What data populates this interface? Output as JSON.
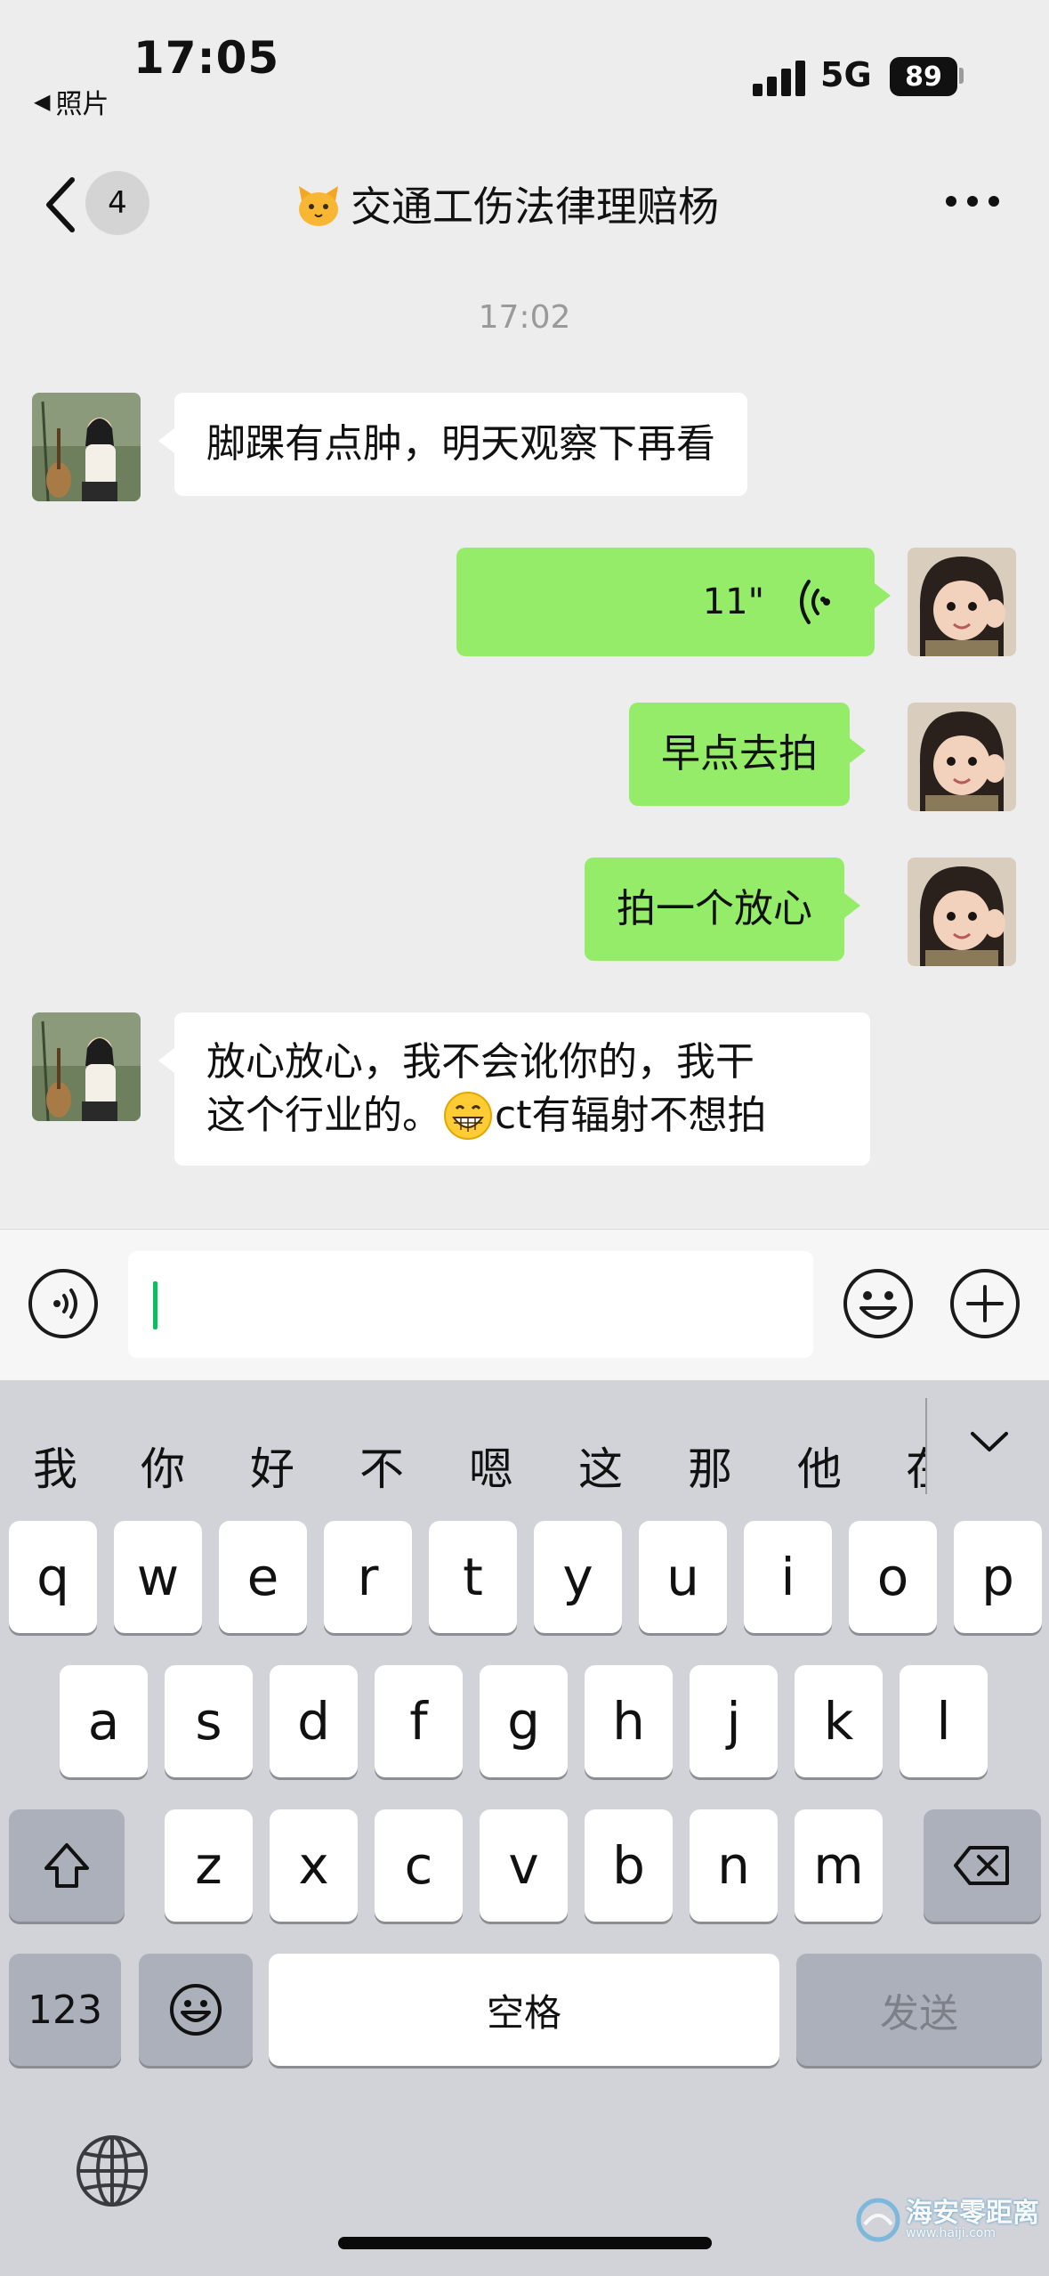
{
  "status_bar": {
    "time": "17:05",
    "back_app": "照片",
    "network": "5G",
    "battery": "89"
  },
  "nav": {
    "unread_count": "4",
    "title": "交通工伤法律理赔杨"
  },
  "chat": {
    "timestamp": "17:02",
    "messages": [
      {
        "direction": "incoming",
        "type": "text",
        "text": "脚踝有点肿，明天观察下再看"
      },
      {
        "direction": "outgoing",
        "type": "voice",
        "duration": "11\""
      },
      {
        "direction": "outgoing",
        "type": "text",
        "text": "早点去拍"
      },
      {
        "direction": "outgoing",
        "type": "text",
        "text": "拍一个放心"
      },
      {
        "direction": "incoming",
        "type": "text",
        "line1": "放心放心，我不会讹你的，我干",
        "line2_before": "这个行业的。",
        "line2_emoji": "grinning-face-icon",
        "line2_after": "ct有辐射不想拍"
      }
    ]
  },
  "input_bar": {
    "value": ""
  },
  "keyboard": {
    "candidates": [
      "我",
      "你",
      "好",
      "不",
      "嗯",
      "这",
      "那",
      "他",
      "在"
    ],
    "row1": [
      "q",
      "w",
      "e",
      "r",
      "t",
      "y",
      "u",
      "i",
      "o",
      "p"
    ],
    "row2": [
      "a",
      "s",
      "d",
      "f",
      "g",
      "h",
      "j",
      "k",
      "l"
    ],
    "row3": [
      "z",
      "x",
      "c",
      "v",
      "b",
      "n",
      "m"
    ],
    "numbers_key": "123",
    "space_key": "空格",
    "send_key": "发送"
  },
  "watermark": {
    "name": "海安零距离",
    "url": "www.haiji.com"
  },
  "colors": {
    "outgoing_bubble": "#95ec69",
    "incoming_bubble": "#ffffff",
    "caret": "#07c160",
    "background": "#ededed"
  }
}
